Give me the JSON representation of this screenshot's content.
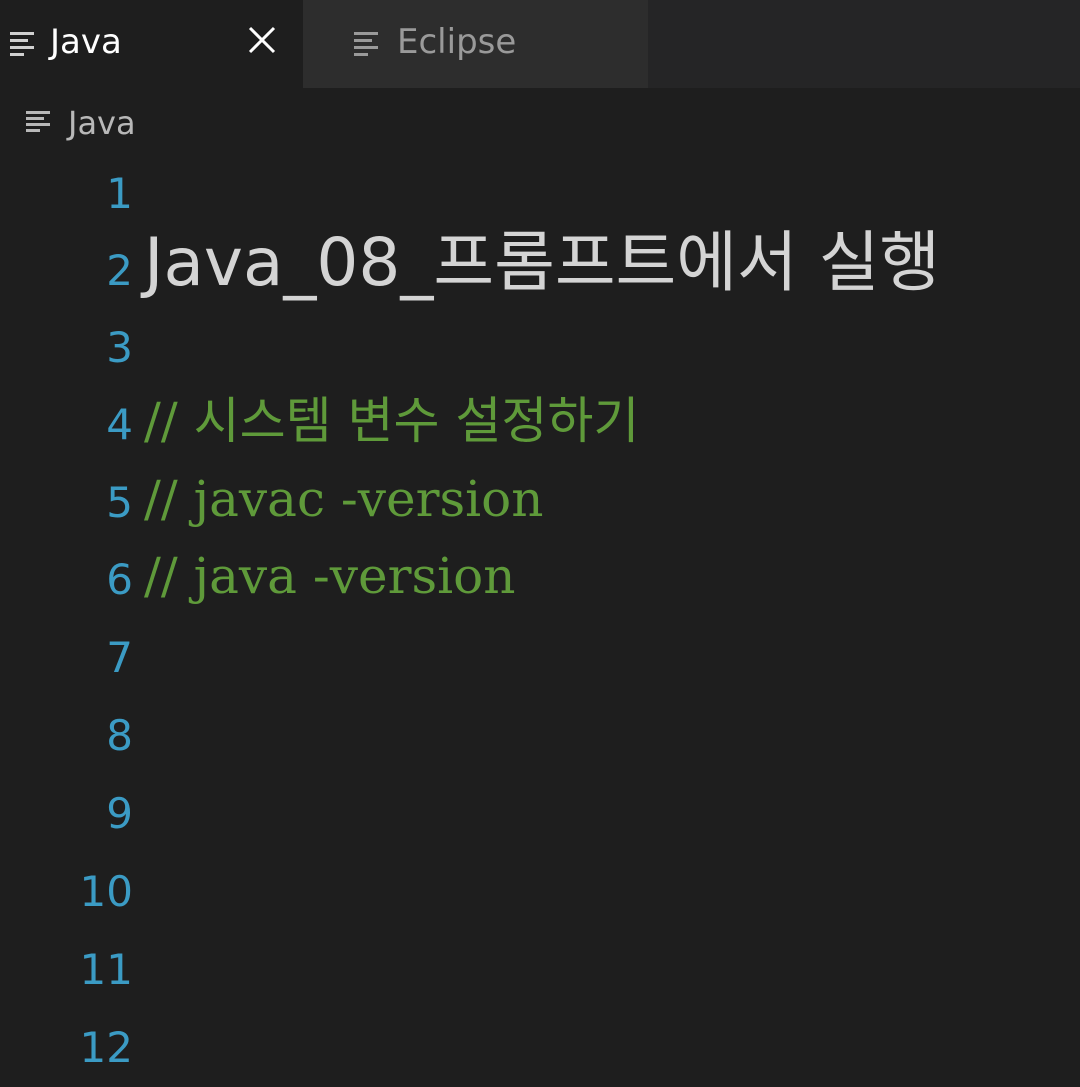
{
  "tabs": [
    {
      "label": "Java",
      "active": true,
      "icon": "lines-icon",
      "closable": true
    },
    {
      "label": "Eclipse",
      "active": false,
      "icon": "lines-icon"
    }
  ],
  "breadcrumb": {
    "icon": "lines-icon",
    "label": "Java"
  },
  "editor": {
    "lines": [
      {
        "number": "1",
        "text": "",
        "kind": "plain"
      },
      {
        "number": "2",
        "text": "Java_08_프롬프트에서 실행",
        "kind": "title"
      },
      {
        "number": "3",
        "text": "",
        "kind": "plain"
      },
      {
        "number": "4",
        "text": "// 시스템 변수 설정하기",
        "kind": "comment"
      },
      {
        "number": "5",
        "text": "// javac -version",
        "kind": "comment"
      },
      {
        "number": "6",
        "text": "// java -version",
        "kind": "comment"
      },
      {
        "number": "7",
        "text": "",
        "kind": "plain"
      },
      {
        "number": "8",
        "text": "",
        "kind": "plain"
      },
      {
        "number": "9",
        "text": "",
        "kind": "plain"
      },
      {
        "number": "10",
        "text": "",
        "kind": "plain"
      },
      {
        "number": "11",
        "text": "",
        "kind": "plain"
      },
      {
        "number": "12",
        "text": "",
        "kind": "plain"
      }
    ]
  },
  "colors": {
    "background": "#1e1e1e",
    "tabbar": "#252526",
    "line_number": "#3b9bc4",
    "comment": "#5f9a3a",
    "text": "#d4d4d4"
  }
}
